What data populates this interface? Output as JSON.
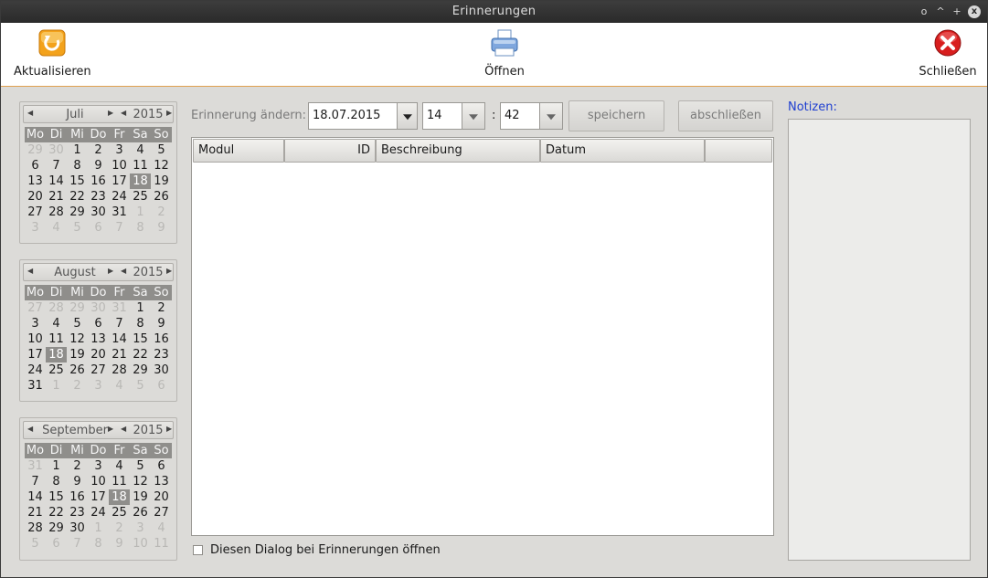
{
  "window": {
    "title": "Erinnerungen",
    "controls": [
      "o",
      "^",
      "+",
      "x"
    ]
  },
  "toolbar": {
    "refresh_label": "Aktualisieren",
    "open_label": "Öffnen",
    "close_label": "Schließen"
  },
  "weekdays": [
    "Mo",
    "Di",
    "Mi",
    "Do",
    "Fr",
    "Sa",
    "So"
  ],
  "calendars": [
    {
      "month": "Juli",
      "year": "2015",
      "weeks": [
        [
          {
            "d": "29",
            "o": true
          },
          {
            "d": "30",
            "o": true
          },
          {
            "d": "1"
          },
          {
            "d": "2"
          },
          {
            "d": "3"
          },
          {
            "d": "4"
          },
          {
            "d": "5"
          }
        ],
        [
          {
            "d": "6"
          },
          {
            "d": "7"
          },
          {
            "d": "8"
          },
          {
            "d": "9"
          },
          {
            "d": "10"
          },
          {
            "d": "11"
          },
          {
            "d": "12"
          }
        ],
        [
          {
            "d": "13"
          },
          {
            "d": "14"
          },
          {
            "d": "15"
          },
          {
            "d": "16"
          },
          {
            "d": "17"
          },
          {
            "d": "18",
            "s": true
          },
          {
            "d": "19"
          }
        ],
        [
          {
            "d": "20"
          },
          {
            "d": "21"
          },
          {
            "d": "22"
          },
          {
            "d": "23"
          },
          {
            "d": "24"
          },
          {
            "d": "25"
          },
          {
            "d": "26"
          }
        ],
        [
          {
            "d": "27"
          },
          {
            "d": "28"
          },
          {
            "d": "29"
          },
          {
            "d": "30"
          },
          {
            "d": "31"
          },
          {
            "d": "1",
            "o": true
          },
          {
            "d": "2",
            "o": true
          }
        ],
        [
          {
            "d": "3",
            "o": true
          },
          {
            "d": "4",
            "o": true
          },
          {
            "d": "5",
            "o": true
          },
          {
            "d": "6",
            "o": true
          },
          {
            "d": "7",
            "o": true
          },
          {
            "d": "8",
            "o": true
          },
          {
            "d": "9",
            "o": true
          }
        ]
      ]
    },
    {
      "month": "August",
      "year": "2015",
      "weeks": [
        [
          {
            "d": "27",
            "o": true
          },
          {
            "d": "28",
            "o": true
          },
          {
            "d": "29",
            "o": true
          },
          {
            "d": "30",
            "o": true
          },
          {
            "d": "31",
            "o": true
          },
          {
            "d": "1"
          },
          {
            "d": "2"
          }
        ],
        [
          {
            "d": "3"
          },
          {
            "d": "4"
          },
          {
            "d": "5"
          },
          {
            "d": "6"
          },
          {
            "d": "7"
          },
          {
            "d": "8"
          },
          {
            "d": "9"
          }
        ],
        [
          {
            "d": "10"
          },
          {
            "d": "11"
          },
          {
            "d": "12"
          },
          {
            "d": "13"
          },
          {
            "d": "14"
          },
          {
            "d": "15"
          },
          {
            "d": "16"
          }
        ],
        [
          {
            "d": "17"
          },
          {
            "d": "18",
            "s": true
          },
          {
            "d": "19"
          },
          {
            "d": "20"
          },
          {
            "d": "21"
          },
          {
            "d": "22"
          },
          {
            "d": "23"
          }
        ],
        [
          {
            "d": "24"
          },
          {
            "d": "25"
          },
          {
            "d": "26"
          },
          {
            "d": "27"
          },
          {
            "d": "28"
          },
          {
            "d": "29"
          },
          {
            "d": "30"
          }
        ],
        [
          {
            "d": "31"
          },
          {
            "d": "1",
            "o": true
          },
          {
            "d": "2",
            "o": true
          },
          {
            "d": "3",
            "o": true
          },
          {
            "d": "4",
            "o": true
          },
          {
            "d": "5",
            "o": true
          },
          {
            "d": "6",
            "o": true
          }
        ]
      ]
    },
    {
      "month": "September",
      "year": "2015",
      "weeks": [
        [
          {
            "d": "31",
            "o": true
          },
          {
            "d": "1"
          },
          {
            "d": "2"
          },
          {
            "d": "3"
          },
          {
            "d": "4"
          },
          {
            "d": "5"
          },
          {
            "d": "6"
          }
        ],
        [
          {
            "d": "7"
          },
          {
            "d": "8"
          },
          {
            "d": "9"
          },
          {
            "d": "10"
          },
          {
            "d": "11"
          },
          {
            "d": "12"
          },
          {
            "d": "13"
          }
        ],
        [
          {
            "d": "14"
          },
          {
            "d": "15"
          },
          {
            "d": "16"
          },
          {
            "d": "17"
          },
          {
            "d": "18",
            "s": true
          },
          {
            "d": "19"
          },
          {
            "d": "20"
          }
        ],
        [
          {
            "d": "21"
          },
          {
            "d": "22"
          },
          {
            "d": "23"
          },
          {
            "d": "24"
          },
          {
            "d": "25"
          },
          {
            "d": "26"
          },
          {
            "d": "27"
          }
        ],
        [
          {
            "d": "28"
          },
          {
            "d": "29"
          },
          {
            "d": "30"
          },
          {
            "d": "1",
            "o": true
          },
          {
            "d": "2",
            "o": true
          },
          {
            "d": "3",
            "o": true
          },
          {
            "d": "4",
            "o": true
          }
        ],
        [
          {
            "d": "5",
            "o": true
          },
          {
            "d": "6",
            "o": true
          },
          {
            "d": "7",
            "o": true
          },
          {
            "d": "8",
            "o": true
          },
          {
            "d": "9",
            "o": true
          },
          {
            "d": "10",
            "o": true
          },
          {
            "d": "11",
            "o": true
          }
        ]
      ]
    }
  ],
  "editor": {
    "label": "Erinnerung ändern:",
    "date_value": "18.07.2015",
    "hour_value": "14",
    "minute_value": "42",
    "colon": ":",
    "save_label": "speichern",
    "finish_label": "abschließen"
  },
  "table": {
    "columns": [
      "Modul",
      "ID",
      "Beschreibung",
      "Datum",
      ""
    ]
  },
  "footer": {
    "checkbox_label": "Diesen Dialog bei Erinnerungen öffnen",
    "checked": false
  },
  "notes": {
    "label": "Notizen:"
  },
  "colors": {
    "accent": "#e0a050",
    "notes_label": "#1f3fd0",
    "selected_day": "#8f8e8b"
  }
}
